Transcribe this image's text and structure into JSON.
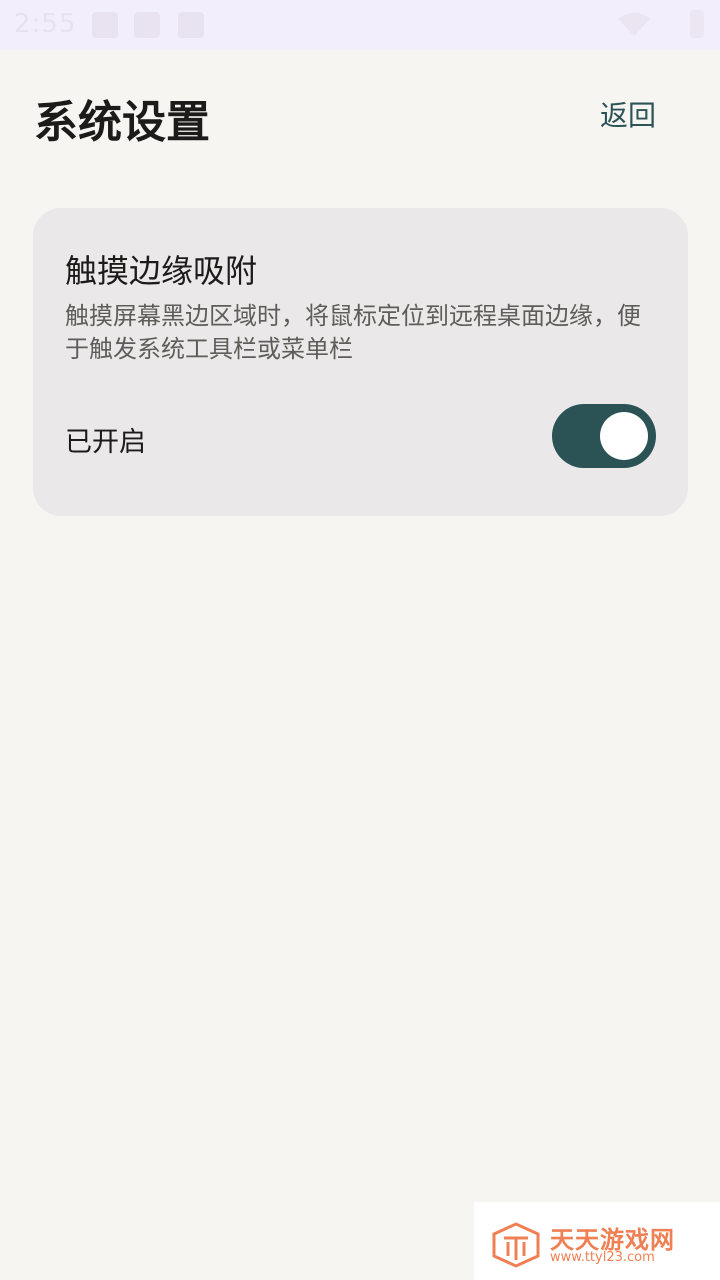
{
  "status_bar": {
    "time": "2:55"
  },
  "header": {
    "title": "系统设置",
    "back_label": "返回"
  },
  "setting_card": {
    "title": "触摸边缘吸附",
    "description": "触摸屏幕黑边区域时，将鼠标定位到远程桌面边缘，便于触发系统工具栏或菜单栏",
    "status_label": "已开启",
    "toggle_on": true
  },
  "watermark": {
    "title": "天天游戏网",
    "url": "www.ttyl23.com"
  },
  "colors": {
    "accent": "#2b5356",
    "background": "#f7f5f2",
    "card": "#ebe8e9",
    "watermark": "#ef8054"
  }
}
